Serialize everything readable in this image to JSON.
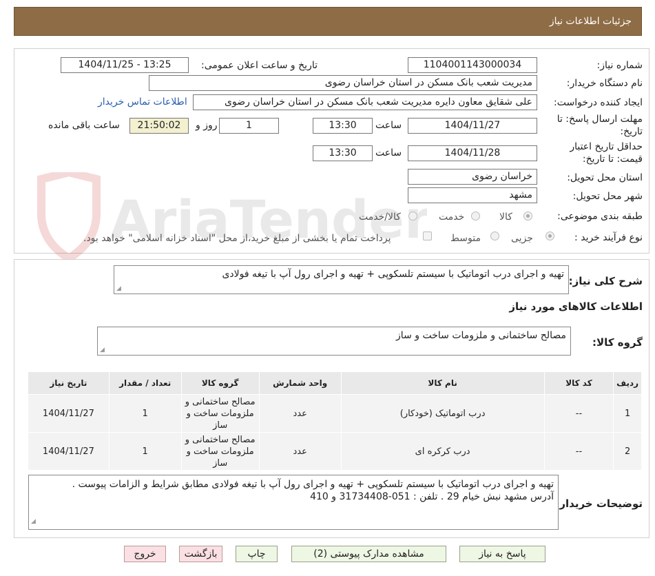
{
  "header": {
    "title": "جزئیات اطلاعات نیاز"
  },
  "watermark": {
    "text": "AriaTender.neT"
  },
  "info": {
    "need_number_label": "شماره نیاز:",
    "need_number": "1104001143000034",
    "announce_label": "تاریخ و ساعت اعلان عمومی:",
    "announce_value": "1404/11/25 - 13:25",
    "buyer_label": "نام دستگاه خریدار:",
    "buyer_value": "مدیریت شعب بانک مسکن در استان خراسان رضوی",
    "creator_label": "ایجاد کننده درخواست:",
    "creator_value": "علی شقایق معاون دایره مدیریت شعب بانک مسکن در استان خراسان رضوی",
    "contact_link": "اطلاعات تماس خریدار",
    "deadline_label_1": "مهلت ارسال پاسخ: تا",
    "deadline_label_2": "تاریخ:",
    "deadline_date": "1404/11/27",
    "time_label": "ساعت",
    "deadline_time": "13:30",
    "days_value": "1",
    "days_label": "روز و",
    "remaining_time": "21:50:02",
    "remaining_label": "ساعت باقی مانده",
    "validity_label_1": "حداقل تاریخ اعتبار",
    "validity_label_2": "قیمت: تا تاریخ:",
    "validity_date": "1404/11/28",
    "validity_time": "13:30",
    "province_label": "استان محل تحویل:",
    "province_value": "خراسان رضوی",
    "city_label": "شهر محل تحویل:",
    "city_value": "مشهد",
    "category_label": "طبقه بندی موضوعی:",
    "category_options": [
      "کالا",
      "خدمت",
      "کالا/خدمت"
    ],
    "process_label": "نوع فرآیند خرید :",
    "process_options": [
      "جزیی",
      "متوسط"
    ],
    "payment_note": "پرداخت تمام یا بخشی از مبلغ خرید،از محل \"اسناد خزانه اسلامی\" خواهد بود."
  },
  "summary": {
    "label": "شرح کلی نیاز:",
    "value": "تهیه و اجرای درب اتوماتیک با سیستم تلسکوپی + تهیه و اجرای رول آپ با تیغه فولادی"
  },
  "goods": {
    "section_title": "اطلاعات کالاهای مورد نیاز",
    "group_label": "گروه کالا:",
    "group_value": "مصالح ساختمانی و ملزومات ساخت و ساز",
    "columns": [
      "ردیف",
      "کد کالا",
      "نام کالا",
      "واحد شمارش",
      "گروه کالا",
      "تعداد / مقدار",
      "تاریخ نیاز"
    ],
    "rows": [
      {
        "row": "1",
        "code": "--",
        "name": "درب اتوماتیک (خودکار)",
        "unit": "عدد",
        "group": "مصالح ساختمانی و ملزومات ساخت و ساز",
        "qty": "1",
        "date": "1404/11/27"
      },
      {
        "row": "2",
        "code": "--",
        "name": "درب کرکره ای",
        "unit": "عدد",
        "group": "مصالح ساختمانی و ملزومات ساخت و ساز",
        "qty": "1",
        "date": "1404/11/27"
      }
    ]
  },
  "buyer_notes": {
    "label": "توضیحات خریدار:",
    "line1": "تهیه و اجرای درب اتوماتیک با سیستم تلسکوپی + تهیه و اجرای رول آپ با تیغه فولادی مطابق شرایط و الزامات پیوست .",
    "line2": "آدرس مشهد نبش خیام 29 . تلفن : 051-31734408 و 410"
  },
  "buttons": {
    "reply": "پاسخ به نیاز",
    "attachments": "مشاهده مدارک پیوستی (2)",
    "print": "چاپ",
    "back": "بازگشت",
    "exit": "خروج"
  }
}
